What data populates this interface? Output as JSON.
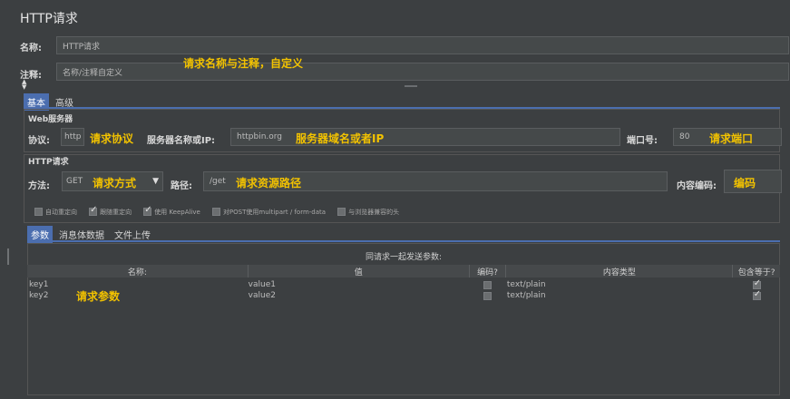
{
  "window_title": "HTTP请求",
  "name_label": "名称:",
  "name_value": "HTTP请求",
  "comment_label": "注释:",
  "comment_value": "名称/注释自定义",
  "annotation_name": "请求名称与注释，自定义",
  "tabs": {
    "basic": "基本",
    "advanced": "高级"
  },
  "web_server": {
    "section_title": "Web服务器",
    "protocol_label": "协议:",
    "protocol_value": "http",
    "annotation_protocol": "请求协议",
    "server_label": "服务器名称或IP:",
    "server_value": "httpbin.org",
    "annotation_server": "服务器域名或者IP",
    "port_label": "端口号:",
    "port_value": "80",
    "annotation_port": "请求端口"
  },
  "http_request": {
    "section_title": "HTTP请求",
    "method_label": "方法:",
    "method_value": "GET",
    "annotation_method": "请求方式",
    "path_label": "路径:",
    "path_value": "/get",
    "annotation_path": "请求资源路径",
    "encoding_label": "内容编码:",
    "annotation_encoding": "编码"
  },
  "options": [
    {
      "label": "自动重定向",
      "checked": false
    },
    {
      "label": "跟随重定向",
      "checked": true
    },
    {
      "label": "使用 KeepAlive",
      "checked": true
    },
    {
      "label": "对POST使用multipart / form-data",
      "checked": false
    },
    {
      "label": "与浏览器兼容的头",
      "checked": false
    }
  ],
  "param_tabs": {
    "params": "参数",
    "body": "消息体数据",
    "files": "文件上传"
  },
  "params_table": {
    "caption": "同请求一起发送参数:",
    "headers": [
      "名称:",
      "值",
      "编码?",
      "内容类型",
      "包含等于?"
    ],
    "rows": [
      {
        "name": "key1",
        "value": "value1",
        "encode": false,
        "content_type": "text/plain",
        "include_equals": true
      },
      {
        "name": "key2",
        "value": "value2",
        "encode": false,
        "content_type": "text/plain",
        "include_equals": true
      }
    ],
    "annotation_params": "请求参数"
  }
}
